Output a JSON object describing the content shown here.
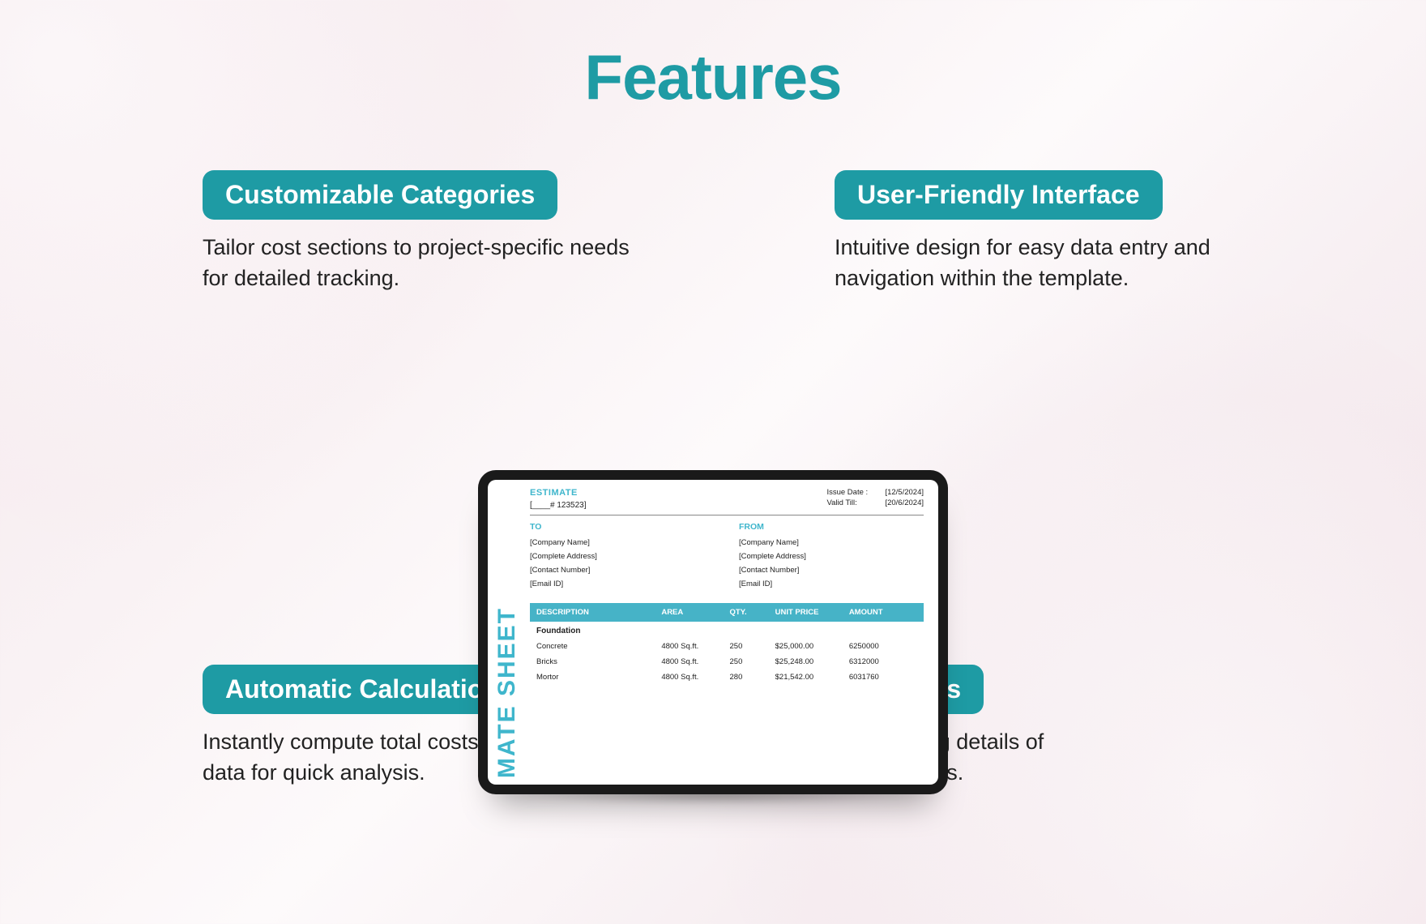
{
  "title": "Features",
  "features": {
    "top_left": {
      "pill": "Customizable Categories",
      "desc": "Tailor cost sections to project-specific needs for detailed tracking."
    },
    "top_right": {
      "pill": "User-Friendly Interface",
      "desc": "Intuitive design for easy data entry and navigation within the template."
    },
    "bottom_left": {
      "pill": "Automatic Calculations",
      "desc": "Instantly compute total costs based on entered data for quick analysis."
    },
    "bottom_right": {
      "pill": "Correspondence Details",
      "desc": "Includes a section for specifying details of correspondence between parties."
    }
  },
  "tablet": {
    "side_title": "MATE SHEET",
    "estimate": {
      "heading": "ESTIMATE",
      "number": "[____# 123523]"
    },
    "dates": {
      "issue_label": "Issue Date :",
      "issue_value": "[12/5/2024]",
      "valid_label": "Valid Till:",
      "valid_value": "[20/6/2024]"
    },
    "to": {
      "heading": "TO",
      "company": "[Company Name]",
      "address": "[Complete Address]",
      "contact": "[Contact Number]",
      "email": "[Email ID]"
    },
    "from": {
      "heading": "FROM",
      "company": "[Company Name]",
      "address": "[Complete Address]",
      "contact": "[Contact Number]",
      "email": "[Email ID]"
    },
    "table": {
      "headers": {
        "desc": "DESCRIPTION",
        "area": "AREA",
        "qty": "QTY.",
        "unit": "UNIT PRICE",
        "amount": "AMOUNT"
      },
      "section": "Foundation",
      "rows": [
        {
          "desc": "Concrete",
          "area": "4800 Sq.ft.",
          "qty": "250",
          "unit": "$25,000.00",
          "amount": "6250000"
        },
        {
          "desc": "Bricks",
          "area": "4800 Sq.ft.",
          "qty": "250",
          "unit": "$25,248.00",
          "amount": "6312000"
        },
        {
          "desc": "Mortor",
          "area": "4800 Sq.ft.",
          "qty": "280",
          "unit": "$21,542.00",
          "amount": "6031760"
        }
      ]
    }
  }
}
